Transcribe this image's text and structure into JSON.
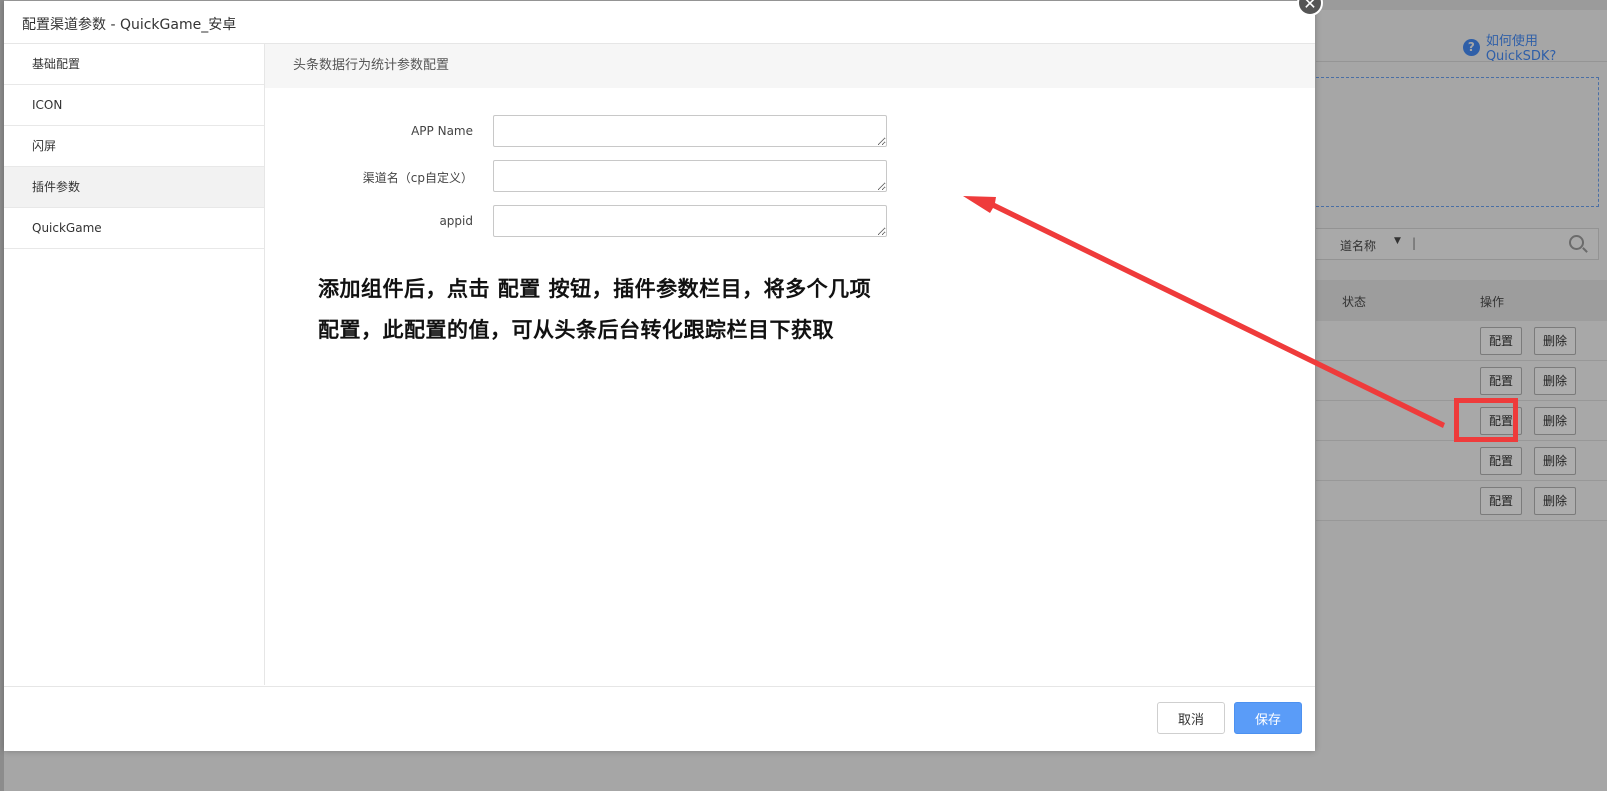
{
  "dialog": {
    "title": "配置渠道参数 - QuickGame_安卓",
    "close_icon": "close-icon",
    "sidebar": {
      "items": [
        {
          "label": "基础配置",
          "active": false
        },
        {
          "label": "ICON",
          "active": false
        },
        {
          "label": "闪屏",
          "active": false
        },
        {
          "label": "插件参数",
          "active": true
        },
        {
          "label": "QuickGame",
          "active": false
        }
      ]
    },
    "section_title": "头条数据行为统计参数配置",
    "fields": [
      {
        "label": "APP Name",
        "value": ""
      },
      {
        "label": "渠道名（cp自定义）",
        "value": ""
      },
      {
        "label": "appid",
        "value": ""
      }
    ],
    "annotation": {
      "line1": "添加组件后，点击 配置 按钮，插件参数栏目，将多个几项",
      "line2": "配置，此配置的值，可从头条后台转化跟踪栏目下获取",
      "color": "#ef3b3b"
    },
    "footer": {
      "cancel_label": "取消",
      "save_label": "保存"
    }
  },
  "background": {
    "help_link": "如何使用QuickSDK?",
    "help_icon": "question-icon",
    "filter": {
      "label": "道名称",
      "caret": "▼",
      "cursor": "|",
      "icon": "search-icon"
    },
    "table": {
      "headers": [
        "状态",
        "操作"
      ],
      "rows": [
        {
          "config": "配置",
          "delete": "删除"
        },
        {
          "config": "配置",
          "delete": "删除"
        },
        {
          "config": "配置",
          "delete": "删除"
        },
        {
          "config": "配置",
          "delete": "删除"
        },
        {
          "config": "配置",
          "delete": "删除"
        }
      ]
    }
  }
}
